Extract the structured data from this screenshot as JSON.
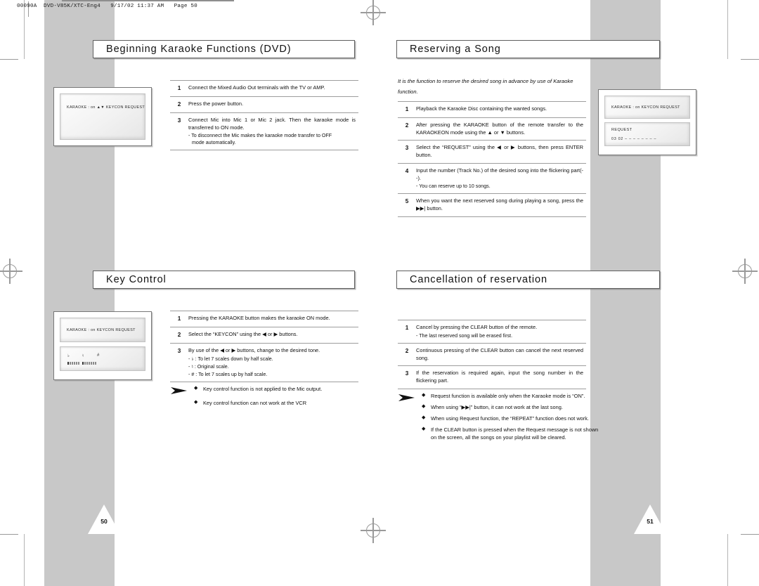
{
  "slug": "00090A  DVD-V85K/XTC-Eng4   9/17/02 11:37 AM   Page 50",
  "left_page": {
    "page_number": "50",
    "sections": [
      {
        "title": "Beginning Karaoke Functions (DVD)",
        "illustration": {
          "osd_top": "KARAOKE : on  ▲▼  KEYCON  REQUEST"
        },
        "steps": [
          {
            "num": "1",
            "text": "Connect the Mixed Audio Out terminals with the TV or AMP.",
            "sub": []
          },
          {
            "num": "2",
            "text": "Press the power button.",
            "sub": []
          },
          {
            "num": "3",
            "text": "Connect Mic into Mic 1 or Mic 2 jack. Then the karaoke mode is transferred to ON mode.",
            "sub": [
              "- To disconnect the Mic makes the karaoke mode transfer to OFF",
              "mode automatically."
            ]
          }
        ]
      },
      {
        "title": "Key Control",
        "illustration": {
          "osd_top": "KARAOKE : on    KEYCON   REQUEST",
          "osd_symbols": [
            "♭",
            "♮",
            "#"
          ]
        },
        "steps": [
          {
            "num": "1",
            "text": "Pressing the KARAOKE button makes the karaoke ON mode.",
            "sub": []
          },
          {
            "num": "2",
            "text": "Select the “KEYCON” using the ◀ or ▶ buttons.",
            "sub": []
          },
          {
            "num": "3",
            "text": "By use of the ◀ or ▶ buttons, change to the desired tone.",
            "sub": [
              "- ♭ : To let 7 scales down by half scale.",
              "- ♮ : Original scale.",
              "- # : To let 7 scales up by half scale."
            ]
          }
        ],
        "notes": [
          "Key control function is not applied to the Mic output.",
          "Key control function can not work at the VCR"
        ]
      }
    ]
  },
  "right_page": {
    "page_number": "51",
    "sections": [
      {
        "title": "Reserving a Song",
        "intro": "It is the function to reserve the desired song in advance by use of Karaoke function.",
        "illustration": {
          "osd_top": "KARAOKE :  on   KEYCON   REQUEST",
          "osd_bottom_label": "REQUEST",
          "osd_bottom_values": "03  02  –  –  –  –  –  –  –  –"
        },
        "steps": [
          {
            "num": "1",
            "text": "Playback the Karaoke Disc containing the wanted songs.",
            "sub": []
          },
          {
            "num": "2",
            "text": "After pressing the KARAOKE button of the remote transfer to the KARAOKEON mode using the ▲ or ▼ buttons.",
            "sub": []
          },
          {
            "num": "3",
            "text": "Select the “REQUEST” using the ◀ or ▶ buttons, then press ENTER button.",
            "sub": []
          },
          {
            "num": "4",
            "text": "Input the number (Track No.) of the desired song into the flickering part(--).",
            "sub": [
              "-  You can reserve up to 10 songs."
            ]
          },
          {
            "num": "5",
            "text": "When you want the next reserved song during playing a song, press the ▶▶| button.",
            "sub": []
          }
        ]
      },
      {
        "title": "Cancellation of reservation",
        "steps": [
          {
            "num": "1",
            "text": "Cancel by pressing the CLEAR button of the remote.",
            "sub": [
              "-  The last reserved song will be erased first."
            ]
          },
          {
            "num": "2",
            "text": "Continuous pressing of the CLEAR button can cancel the next reserved song.",
            "sub": []
          },
          {
            "num": "3",
            "text": "If the reservation is required again, input the song number in the flickering part.",
            "sub": []
          }
        ],
        "notes": [
          "Request function is available only when the Karaoke mode is “ON”.",
          "When using “▶▶|” button, it can not work at the last song.",
          "When using Request function, the “REPEAT” function does not work.",
          "If the CLEAR button is pressed when the Request message is not shown on the screen, all the songs on your playlist will be cleared."
        ]
      }
    ]
  }
}
